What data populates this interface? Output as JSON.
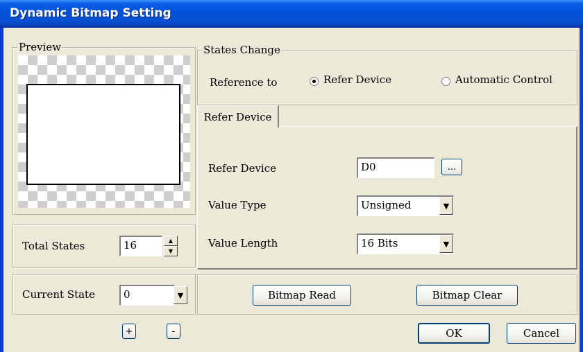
{
  "window": {
    "title": "Dynamic Bitmap Setting"
  },
  "preview": {
    "legend": "Preview"
  },
  "total_states": {
    "label": "Total States",
    "value": "16"
  },
  "current_state": {
    "label": "Current State",
    "value": "0"
  },
  "state_buttons": {
    "add": "+",
    "remove": "-"
  },
  "states_change": {
    "legend": "States Change",
    "reference_label": "Reference to",
    "option_refer_device": "Refer Device",
    "option_automatic_control": "Automatic Control",
    "selected": "Refer Device"
  },
  "tab": {
    "label": "Refer Device"
  },
  "refer_device": {
    "device_label": "Refer Device",
    "device_value": "D0",
    "browse_label": "...",
    "value_type_label": "Value Type",
    "value_type": "Unsigned",
    "value_length_label": "Value Length",
    "value_length": "16 Bits"
  },
  "bitmap_buttons": {
    "read": "Bitmap Read",
    "clear": "Bitmap Clear"
  },
  "dialog_buttons": {
    "ok": "OK",
    "cancel": "Cancel"
  }
}
